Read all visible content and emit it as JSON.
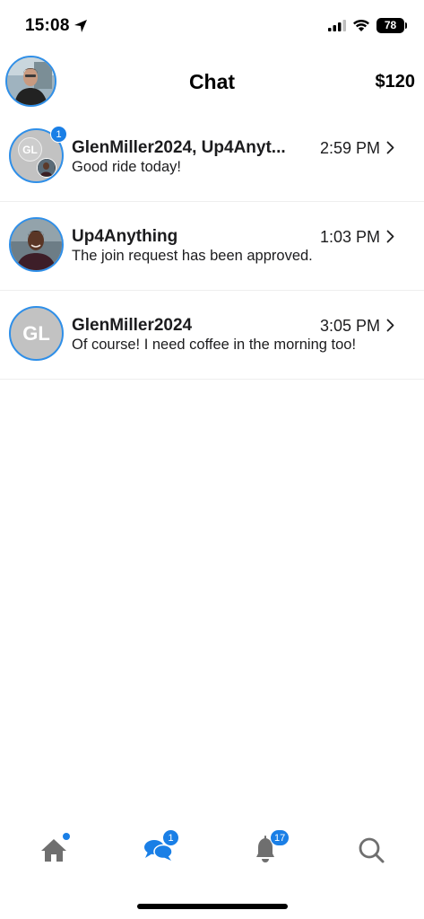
{
  "status_bar": {
    "time": "15:08",
    "battery": "78"
  },
  "header": {
    "title": "Chat",
    "balance": "$120"
  },
  "chats": [
    {
      "name": "GlenMiller2024, Up4Anyt...",
      "time": "2:59 PM",
      "preview": "Good ride today!",
      "avatar_initials": "GL",
      "unread": "1"
    },
    {
      "name": "Up4Anything",
      "time": "1:03 PM",
      "preview": "The join request has been approved."
    },
    {
      "name": "GlenMiller2024",
      "time": "3:05 PM",
      "preview": "Of course!  I need coffee in the morning too!",
      "avatar_initials": "GL"
    }
  ],
  "tabs": {
    "chat_badge": "1",
    "notifications_badge": "17"
  },
  "colors": {
    "accent": "#1a7fe6",
    "avatar_border": "#2f8fe8",
    "tab_icon": "#6f6f6f"
  },
  "icons": [
    "location-arrow-icon",
    "cellular-signal-icon",
    "wifi-icon",
    "battery-icon",
    "chevron-right-icon",
    "home-icon",
    "chat-bubbles-icon",
    "bell-icon",
    "search-icon"
  ]
}
